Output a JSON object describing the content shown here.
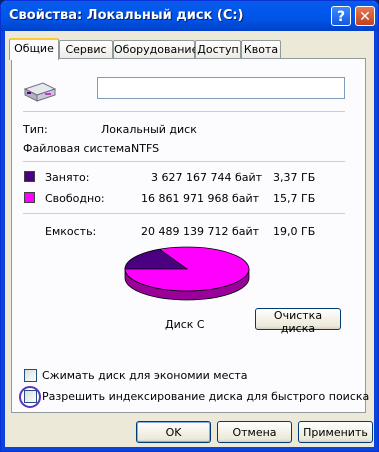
{
  "window": {
    "title": "Свойства: Локальный диск (C:)",
    "help_glyph": "?",
    "close_glyph": "✕"
  },
  "tabs": [
    {
      "label": "Общие",
      "active": true
    },
    {
      "label": "Сервис",
      "active": false
    },
    {
      "label": "Оборудование",
      "active": false
    },
    {
      "label": "Доступ",
      "active": false
    },
    {
      "label": "Квота",
      "active": false
    }
  ],
  "general": {
    "name_value": "",
    "type_label": "Тип:",
    "type_value": "Локальный диск",
    "fs_label": "Файловая система:",
    "fs_value": "NTFS",
    "used": {
      "label": "Занято:",
      "bytes": "3 627 167 744 байт",
      "size": "3,37 ГБ",
      "color": "#4b0082"
    },
    "free": {
      "label": "Свободно:",
      "bytes": "16 861 971 968 байт",
      "size": "15,7 ГБ",
      "color": "#ff00ff"
    },
    "capacity": {
      "label": "Емкость:",
      "bytes": "20 489 139 712 байт",
      "size": "19,0 ГБ"
    },
    "disk_label": "Диск C",
    "cleanup_button": "Очистка диска",
    "compress_label": "Сжимать диск для экономии места",
    "compress_checked": false,
    "index_label": "Разрешить индексирование диска для быстрого поиска",
    "index_checked": false
  },
  "pie": {
    "used_fraction": 0.177,
    "used_color": "#4b0082",
    "free_color": "#ff00ff"
  },
  "buttons": {
    "ok": "OK",
    "cancel": "Отмена",
    "apply": "Применить"
  }
}
